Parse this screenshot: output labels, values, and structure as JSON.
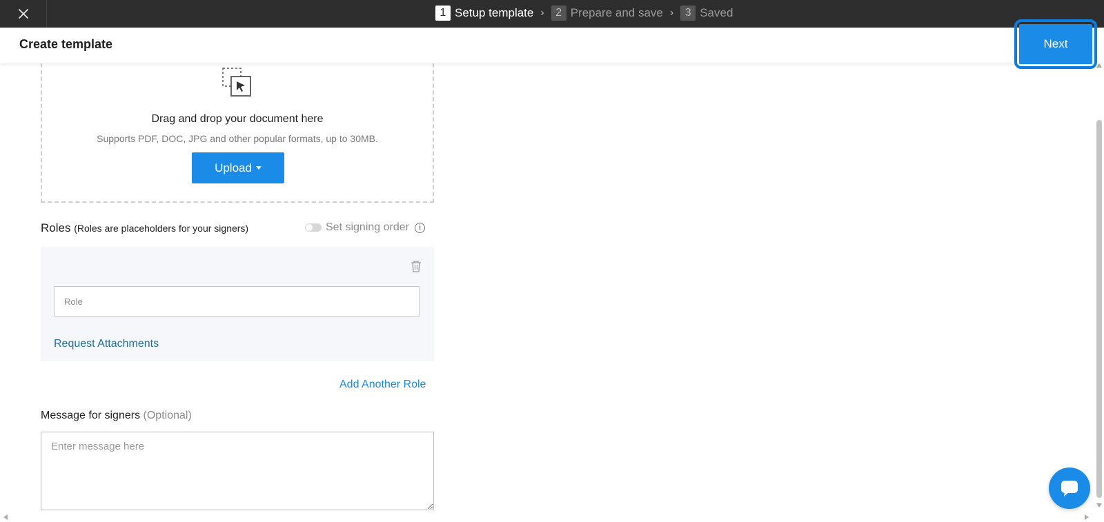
{
  "topbar": {
    "steps": [
      {
        "num": "1",
        "label": "Setup template"
      },
      {
        "num": "2",
        "label": "Prepare and save"
      },
      {
        "num": "3",
        "label": "Saved"
      }
    ],
    "active_step": "1"
  },
  "header": {
    "title": "Create template",
    "next_label": "Next"
  },
  "upload": {
    "title": "Drag and drop your document here",
    "subtitle": "Supports PDF, DOC, JPG and other popular formats, up to 30MB.",
    "button_label": "Upload"
  },
  "roles": {
    "heading": "Roles",
    "subheading": "(Roles are placeholders for your signers)",
    "signing_order_label": "Set signing order",
    "role_placeholder": "Role",
    "request_attachments": "Request Attachments",
    "add_another_role": "Add Another Role"
  },
  "message": {
    "label": "Message for signers",
    "optional": "(Optional)",
    "placeholder": "Enter message here"
  },
  "colors": {
    "accent": "#1a8be6",
    "topbar": "#2e2e2e",
    "role_card_bg": "#f5f7fb"
  }
}
